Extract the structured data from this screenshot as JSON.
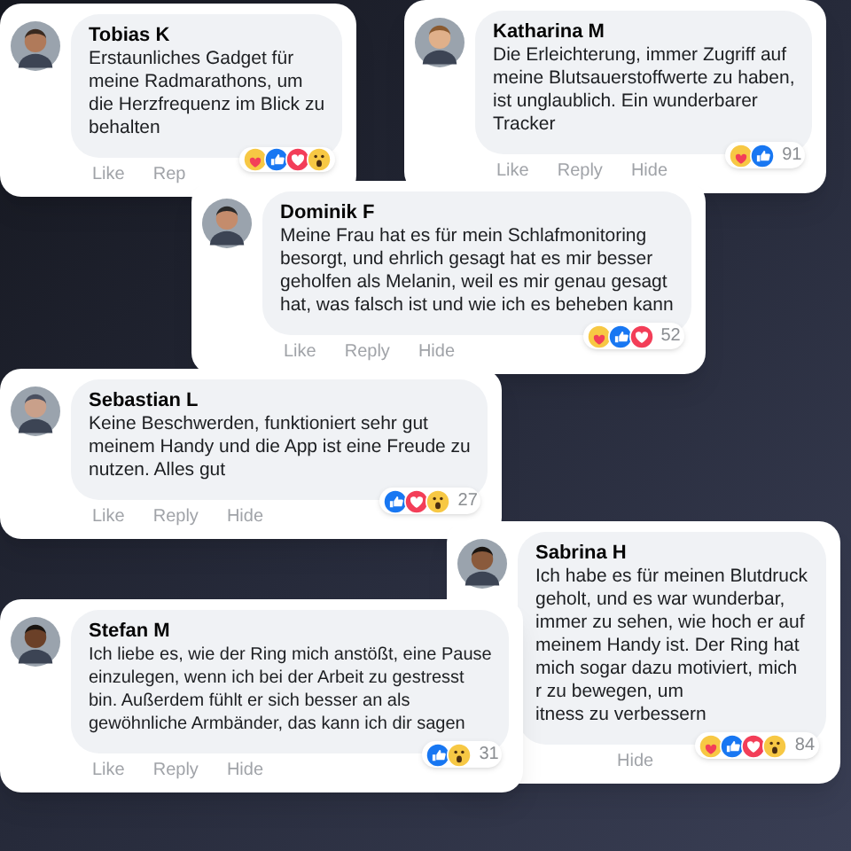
{
  "comments": [
    {
      "name": "Tobias K",
      "lines": [
        "Erstaunliches Gadget für",
        "meine Radmarathons, um",
        "die Herzfrequenz im Blick zu",
        "behalten"
      ],
      "reactions": [
        {
          "kind": "care"
        },
        {
          "kind": "like"
        },
        {
          "kind": "love"
        },
        {
          "kind": "wow"
        }
      ],
      "actions": [
        "Like",
        "Rep"
      ]
    },
    {
      "name": "Katharina M",
      "lines": [
        "Die Erleichterung, immer Zugriff auf",
        "meine Blutsauerstoffwerte zu haben,",
        "ist unglaublich. Ein wunderbarer",
        "Tracker"
      ],
      "reactions": [
        {
          "kind": "care"
        },
        {
          "kind": "like"
        }
      ],
      "count": "91",
      "actions": [
        "Like",
        "Reply",
        "Hide"
      ]
    },
    {
      "name": "Dominik F",
      "lines": [
        "Meine Frau hat es für mein Schlafmonitoring",
        "besorgt, und ehrlich gesagt hat es mir besser",
        "geholfen als Melanin, weil es mir genau gesagt",
        "hat, was falsch ist und wie ich es beheben kann"
      ],
      "reactions": [
        {
          "kind": "care"
        },
        {
          "kind": "like"
        },
        {
          "kind": "love"
        }
      ],
      "count": "52",
      "actions": [
        "Like",
        "Reply",
        "Hide"
      ]
    },
    {
      "name": "Sebastian L",
      "lines": [
        "Keine Beschwerden, funktioniert sehr gut",
        "meinem Handy und die App ist eine Freude zu",
        "nutzen. Alles gut"
      ],
      "reactions": [
        {
          "kind": "like"
        },
        {
          "kind": "love"
        },
        {
          "kind": "wow"
        }
      ],
      "count": "27",
      "actions": [
        "Like",
        "Reply",
        "Hide"
      ]
    },
    {
      "name": "Sabrina H",
      "lines": [
        "Ich habe es für meinen Blutdruck",
        "geholt, und es war wunderbar,",
        "immer zu sehen, wie hoch er auf",
        "meinem Handy ist. Der Ring hat",
        "mich sogar dazu motiviert, mich",
        "r zu bewegen, um",
        "itness zu verbessern"
      ],
      "reactions": [
        {
          "kind": "care"
        },
        {
          "kind": "like"
        },
        {
          "kind": "love"
        },
        {
          "kind": "wow"
        }
      ],
      "count": "84",
      "actions": [
        "Hide"
      ]
    },
    {
      "name": "Stefan M",
      "lines": [
        "Ich liebe es, wie der Ring mich anstößt, eine Pause",
        "einzulegen, wenn ich bei der Arbeit zu gestresst",
        "bin. Außerdem fühlt er sich besser an als",
        "gewöhnliche Armbänder, das kann ich dir sagen"
      ],
      "reactions": [
        {
          "kind": "like"
        },
        {
          "kind": "wow"
        }
      ],
      "count": "31",
      "actions": [
        "Like",
        "Reply",
        "Hide"
      ]
    }
  ]
}
